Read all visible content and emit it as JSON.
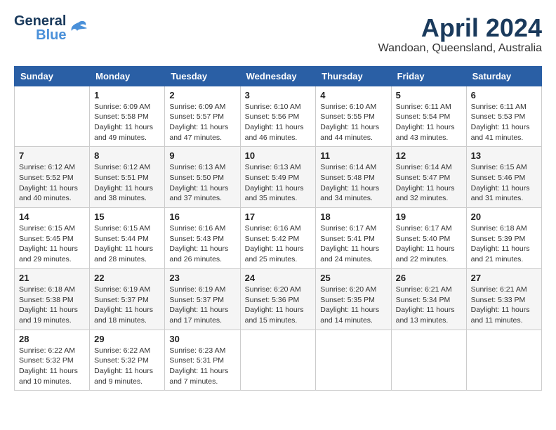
{
  "logo": {
    "general": "General",
    "blue": "Blue"
  },
  "title": "April 2024",
  "location": "Wandoan, Queensland, Australia",
  "days_header": [
    "Sunday",
    "Monday",
    "Tuesday",
    "Wednesday",
    "Thursday",
    "Friday",
    "Saturday"
  ],
  "weeks": [
    [
      {
        "num": "",
        "detail": ""
      },
      {
        "num": "1",
        "detail": "Sunrise: 6:09 AM\nSunset: 5:58 PM\nDaylight: 11 hours\nand 49 minutes."
      },
      {
        "num": "2",
        "detail": "Sunrise: 6:09 AM\nSunset: 5:57 PM\nDaylight: 11 hours\nand 47 minutes."
      },
      {
        "num": "3",
        "detail": "Sunrise: 6:10 AM\nSunset: 5:56 PM\nDaylight: 11 hours\nand 46 minutes."
      },
      {
        "num": "4",
        "detail": "Sunrise: 6:10 AM\nSunset: 5:55 PM\nDaylight: 11 hours\nand 44 minutes."
      },
      {
        "num": "5",
        "detail": "Sunrise: 6:11 AM\nSunset: 5:54 PM\nDaylight: 11 hours\nand 43 minutes."
      },
      {
        "num": "6",
        "detail": "Sunrise: 6:11 AM\nSunset: 5:53 PM\nDaylight: 11 hours\nand 41 minutes."
      }
    ],
    [
      {
        "num": "7",
        "detail": "Sunrise: 6:12 AM\nSunset: 5:52 PM\nDaylight: 11 hours\nand 40 minutes."
      },
      {
        "num": "8",
        "detail": "Sunrise: 6:12 AM\nSunset: 5:51 PM\nDaylight: 11 hours\nand 38 minutes."
      },
      {
        "num": "9",
        "detail": "Sunrise: 6:13 AM\nSunset: 5:50 PM\nDaylight: 11 hours\nand 37 minutes."
      },
      {
        "num": "10",
        "detail": "Sunrise: 6:13 AM\nSunset: 5:49 PM\nDaylight: 11 hours\nand 35 minutes."
      },
      {
        "num": "11",
        "detail": "Sunrise: 6:14 AM\nSunset: 5:48 PM\nDaylight: 11 hours\nand 34 minutes."
      },
      {
        "num": "12",
        "detail": "Sunrise: 6:14 AM\nSunset: 5:47 PM\nDaylight: 11 hours\nand 32 minutes."
      },
      {
        "num": "13",
        "detail": "Sunrise: 6:15 AM\nSunset: 5:46 PM\nDaylight: 11 hours\nand 31 minutes."
      }
    ],
    [
      {
        "num": "14",
        "detail": "Sunrise: 6:15 AM\nSunset: 5:45 PM\nDaylight: 11 hours\nand 29 minutes."
      },
      {
        "num": "15",
        "detail": "Sunrise: 6:15 AM\nSunset: 5:44 PM\nDaylight: 11 hours\nand 28 minutes."
      },
      {
        "num": "16",
        "detail": "Sunrise: 6:16 AM\nSunset: 5:43 PM\nDaylight: 11 hours\nand 26 minutes."
      },
      {
        "num": "17",
        "detail": "Sunrise: 6:16 AM\nSunset: 5:42 PM\nDaylight: 11 hours\nand 25 minutes."
      },
      {
        "num": "18",
        "detail": "Sunrise: 6:17 AM\nSunset: 5:41 PM\nDaylight: 11 hours\nand 24 minutes."
      },
      {
        "num": "19",
        "detail": "Sunrise: 6:17 AM\nSunset: 5:40 PM\nDaylight: 11 hours\nand 22 minutes."
      },
      {
        "num": "20",
        "detail": "Sunrise: 6:18 AM\nSunset: 5:39 PM\nDaylight: 11 hours\nand 21 minutes."
      }
    ],
    [
      {
        "num": "21",
        "detail": "Sunrise: 6:18 AM\nSunset: 5:38 PM\nDaylight: 11 hours\nand 19 minutes."
      },
      {
        "num": "22",
        "detail": "Sunrise: 6:19 AM\nSunset: 5:37 PM\nDaylight: 11 hours\nand 18 minutes."
      },
      {
        "num": "23",
        "detail": "Sunrise: 6:19 AM\nSunset: 5:37 PM\nDaylight: 11 hours\nand 17 minutes."
      },
      {
        "num": "24",
        "detail": "Sunrise: 6:20 AM\nSunset: 5:36 PM\nDaylight: 11 hours\nand 15 minutes."
      },
      {
        "num": "25",
        "detail": "Sunrise: 6:20 AM\nSunset: 5:35 PM\nDaylight: 11 hours\nand 14 minutes."
      },
      {
        "num": "26",
        "detail": "Sunrise: 6:21 AM\nSunset: 5:34 PM\nDaylight: 11 hours\nand 13 minutes."
      },
      {
        "num": "27",
        "detail": "Sunrise: 6:21 AM\nSunset: 5:33 PM\nDaylight: 11 hours\nand 11 minutes."
      }
    ],
    [
      {
        "num": "28",
        "detail": "Sunrise: 6:22 AM\nSunset: 5:32 PM\nDaylight: 11 hours\nand 10 minutes."
      },
      {
        "num": "29",
        "detail": "Sunrise: 6:22 AM\nSunset: 5:32 PM\nDaylight: 11 hours\nand 9 minutes."
      },
      {
        "num": "30",
        "detail": "Sunrise: 6:23 AM\nSunset: 5:31 PM\nDaylight: 11 hours\nand 7 minutes."
      },
      {
        "num": "",
        "detail": ""
      },
      {
        "num": "",
        "detail": ""
      },
      {
        "num": "",
        "detail": ""
      },
      {
        "num": "",
        "detail": ""
      }
    ]
  ]
}
